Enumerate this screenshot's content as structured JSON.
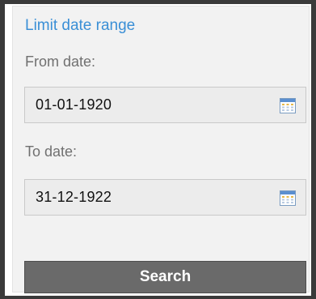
{
  "filter": {
    "title": "Limit date range",
    "from_label": "From date:",
    "from_value": "01-01-1920",
    "to_label": "To date:",
    "to_value": "31-12-1922",
    "search_label": "Search"
  },
  "icons": {
    "calendar": "calendar-icon"
  },
  "colors": {
    "title": "#3a8fd6",
    "button_bg": "#6a6a6a",
    "panel_bg": "#f2f2f2"
  }
}
